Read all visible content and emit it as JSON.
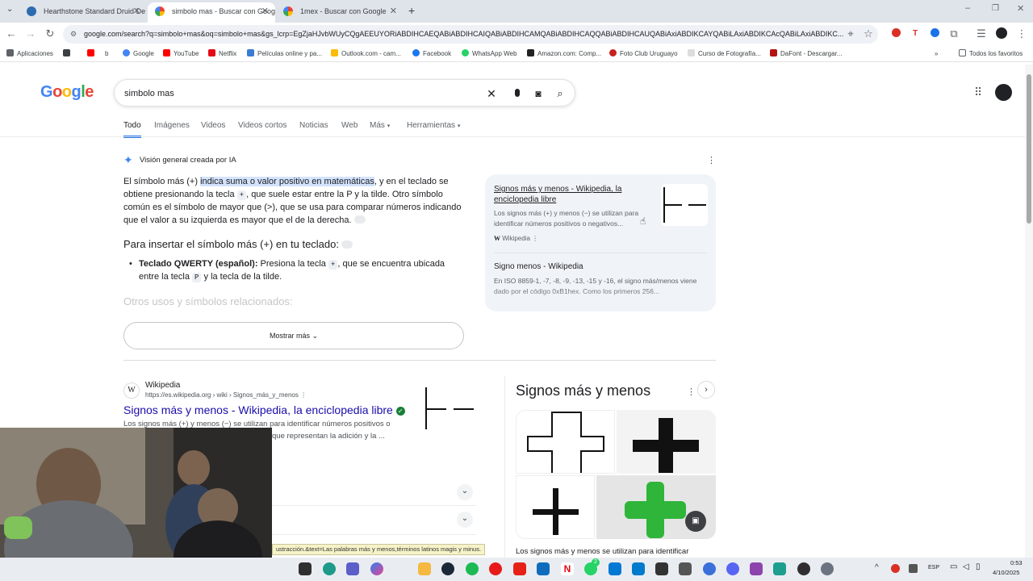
{
  "browser": {
    "tabs": [
      {
        "title": "Hearthstone Standard Druid De",
        "active": false
      },
      {
        "title": "simbolo mas - Buscar con Goog",
        "active": true
      },
      {
        "title": "1mex - Buscar con Google",
        "active": false
      }
    ],
    "url": "google.com/search?q=simbolo+mas&oq=simbolo+mas&gs_lcrp=EgZjaHJvbWUyCQgAEEUYORiABDIHCAEQABiABDIHCAIQABiABDIHCAMQABiABDIHCAQQABiABDIHCAUQABiAxiABDIKCAYQABiLAxiABDIKCAcQABiLAxiABDIKC...",
    "bookmarks": [
      "Aplicaciones",
      "Google",
      "YouTube",
      "Netflix",
      "Películas online y pa...",
      "Outlook.com - cam...",
      "Facebook",
      "WhatsApp Web",
      "Amazon.com: Comp...",
      "Foto Club Uruguayo",
      "Curso de Fotografía...",
      "DaFont - Descargar..."
    ],
    "all_bookmarks": "Todos los favoritos"
  },
  "google": {
    "logo": "Google",
    "query": "simbolo mas",
    "tabs": [
      "Todo",
      "Imágenes",
      "Videos",
      "Videos cortos",
      "Noticias",
      "Web",
      "Más",
      "Herramientas"
    ]
  },
  "ai_overview": {
    "label": "Visión general creada por IA",
    "p1_a": "El símbolo más (+) ",
    "p1_hl": "indica suma o valor positivo en matemáticas",
    "p1_b": ", y en el teclado se obtiene presionando la tecla ",
    "p1_key": "+",
    "p1_c": ", que suele estar entre la P y la tilde. Otro símbolo común es el símbolo de mayor que (>), que se usa para comparar números indicando que el valor a su izquierda es mayor que el de la derecha.",
    "heading": "Para insertar el símbolo más (+) en tu teclado:",
    "bullet_bold": "Teclado QWERTY (español):",
    "bullet_a": " Presiona la tecla ",
    "bullet_key1": "+",
    "bullet_b": ", que se encuentra ubicada entre la tecla ",
    "bullet_key2": "P",
    "bullet_c": " y la tecla de la tilde.",
    "faded_heading": "Otros usos y símbolos relacionados:",
    "more_button": "Mostrar más",
    "sources": [
      {
        "title": "Signos más y menos - Wikipedia, la enciclopedia libre",
        "snippet": "Los signos más (+) y menos (−) se utilizan para identificar números positivos o negativos...",
        "site": "Wikipedia"
      },
      {
        "title": "Signo menos - Wikipedia",
        "snippet": "En ISO 8859-1, -7, -8, -9, -13, -15 y -16, el signo más/menos viene dado por el código 0xB1hex. Como los primeros 256...",
        "site": "Wikipedia"
      }
    ]
  },
  "result": {
    "site": "Wikipedia",
    "url": "https://es.wikipedia.org › wiki › Signos_más_y_menos",
    "title": "Signos más y menos - Wikipedia, la enciclopedia libre",
    "snippet_a": "Los signos más (+) y menos (−) se utilizan para identificar números positivos o",
    "snippet_b": "que representan la adición y la ..."
  },
  "knowledge_panel": {
    "title": "Signos más y menos",
    "caption": "Los signos más y menos se utilizan para identificar"
  },
  "tooltip": "ustracción.&text=Las palabras más y menos,términos latinos magis y minus.",
  "taskbar": {
    "lang": "ESP",
    "time": "0:53",
    "date": "4/10/2025",
    "badge": "2"
  }
}
